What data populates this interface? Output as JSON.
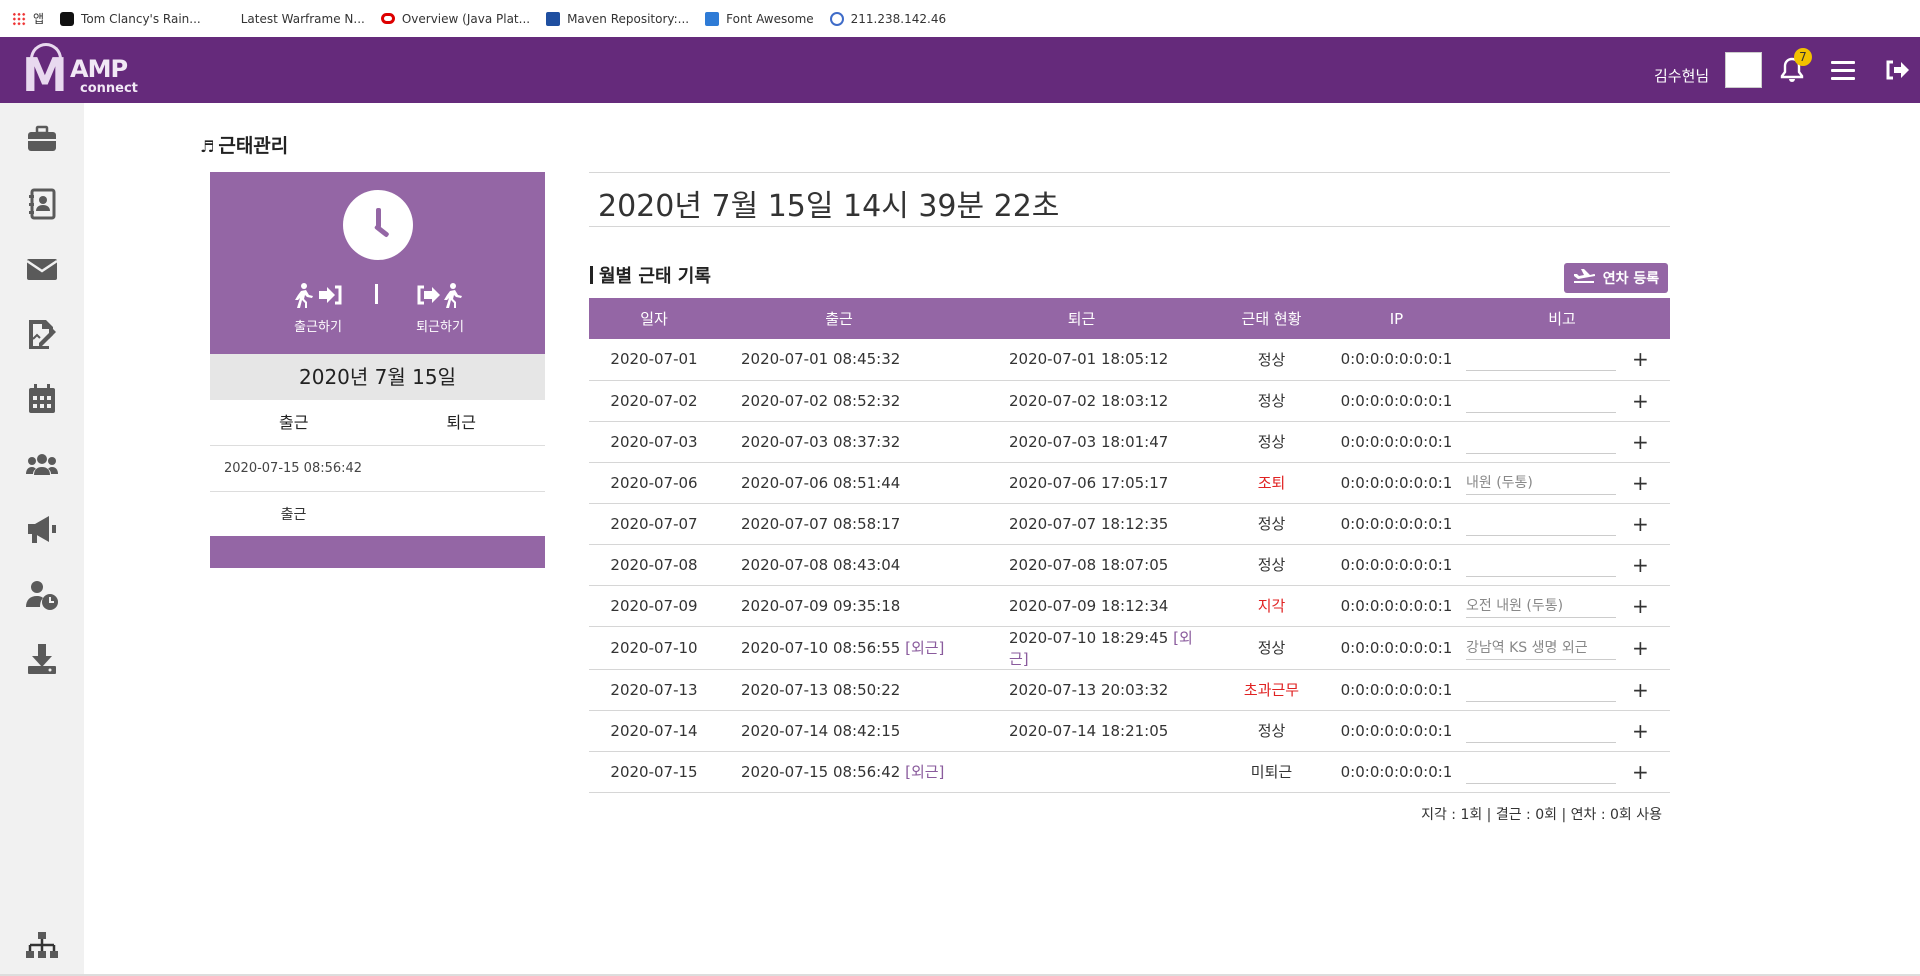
{
  "bookmarks": [
    {
      "label": "앱",
      "icon": "apps-icon"
    },
    {
      "label": "Tom Clancy's Rain...",
      "icon": "r6-icon"
    },
    {
      "label": "Latest Warframe N...",
      "icon": "warframe-icon"
    },
    {
      "label": "Overview (Java Plat...",
      "icon": "oracle-icon"
    },
    {
      "label": "Maven Repository:...",
      "icon": "maven-icon"
    },
    {
      "label": "Font Awesome",
      "icon": "font-awesome-icon"
    },
    {
      "label": "211.238.142.46",
      "icon": "globe-icon"
    }
  ],
  "header": {
    "logo_m": "M",
    "logo_amp": "AMP",
    "logo_connect": "connect",
    "username": "김수현님",
    "notification_count": "7"
  },
  "sidebar_icons": [
    "briefcase-icon",
    "address-book-icon",
    "mail-icon",
    "signature-icon",
    "calendar-icon",
    "users-icon",
    "megaphone-icon",
    "user-clock-icon",
    "download-icon",
    "org-chart-icon"
  ],
  "page": {
    "title": "근태관리",
    "datetime": "2020년 7월 15일 14시 39분 22초"
  },
  "card": {
    "checkin_label": "출근하기",
    "checkout_label": "퇴근하기",
    "date": "2020년 7월 15일",
    "col_in": "출근",
    "col_out": "퇴근",
    "in_time": "2020-07-15 08:56:42",
    "status": "출근"
  },
  "monthly": {
    "title": "월별 근태 기록",
    "leave_button": "연차 등록",
    "columns": [
      "일자",
      "출근",
      "퇴근",
      "근태 현황",
      "IP",
      "비고"
    ],
    "rows": [
      {
        "date": "2020-07-01",
        "in": "2020-07-01 08:45:32",
        "in_tag": "",
        "out": "2020-07-01 18:05:12",
        "out_tag": "",
        "status": "정상",
        "status_color": "#333333",
        "ip": "0:0:0:0:0:0:0:1",
        "note": ""
      },
      {
        "date": "2020-07-02",
        "in": "2020-07-02 08:52:32",
        "in_tag": "",
        "out": "2020-07-02 18:03:12",
        "out_tag": "",
        "status": "정상",
        "status_color": "#333333",
        "ip": "0:0:0:0:0:0:0:1",
        "note": ""
      },
      {
        "date": "2020-07-03",
        "in": "2020-07-03 08:37:32",
        "in_tag": "",
        "out": "2020-07-03 18:01:47",
        "out_tag": "",
        "status": "정상",
        "status_color": "#333333",
        "ip": "0:0:0:0:0:0:0:1",
        "note": ""
      },
      {
        "date": "2020-07-06",
        "in": "2020-07-06 08:51:44",
        "in_tag": "",
        "out": "2020-07-06 17:05:17",
        "out_tag": "",
        "status": "조퇴",
        "status_color": "#e02222",
        "ip": "0:0:0:0:0:0:0:1",
        "note": "내원 (두통)"
      },
      {
        "date": "2020-07-07",
        "in": "2020-07-07 08:58:17",
        "in_tag": "",
        "out": "2020-07-07 18:12:35",
        "out_tag": "",
        "status": "정상",
        "status_color": "#333333",
        "ip": "0:0:0:0:0:0:0:1",
        "note": ""
      },
      {
        "date": "2020-07-08",
        "in": "2020-07-08 08:43:04",
        "in_tag": "",
        "out": "2020-07-08 18:07:05",
        "out_tag": "",
        "status": "정상",
        "status_color": "#333333",
        "ip": "0:0:0:0:0:0:0:1",
        "note": ""
      },
      {
        "date": "2020-07-09",
        "in": "2020-07-09 09:35:18",
        "in_tag": "",
        "out": "2020-07-09 18:12:34",
        "out_tag": "",
        "status": "지각",
        "status_color": "#e02222",
        "ip": "0:0:0:0:0:0:0:1",
        "note": "오전 내원 (두통)"
      },
      {
        "date": "2020-07-10",
        "in": "2020-07-10 08:56:55",
        "in_tag": "[외근]",
        "out": "2020-07-10 18:29:45",
        "out_tag": "[외근]",
        "status": "정상",
        "status_color": "#333333",
        "ip": "0:0:0:0:0:0:0:1",
        "note": "강남역 KS 생명 외근"
      },
      {
        "date": "2020-07-13",
        "in": "2020-07-13 08:50:22",
        "in_tag": "",
        "out": "2020-07-13 20:03:32",
        "out_tag": "",
        "status": "초과근무",
        "status_color": "#e02222",
        "ip": "0:0:0:0:0:0:0:1",
        "note": ""
      },
      {
        "date": "2020-07-14",
        "in": "2020-07-14 08:42:15",
        "in_tag": "",
        "out": "2020-07-14 18:21:05",
        "out_tag": "",
        "status": "정상",
        "status_color": "#333333",
        "ip": "0:0:0:0:0:0:0:1",
        "note": ""
      },
      {
        "date": "2020-07-15",
        "in": "2020-07-15 08:56:42",
        "in_tag": "[외근]",
        "out": "",
        "out_tag": "",
        "status": "미퇴근",
        "status_color": "#333333",
        "ip": "0:0:0:0:0:0:0:1",
        "note": ""
      }
    ],
    "plus_label": "+",
    "summary": "지각 : 1회 | 결근 : 0회 | 연차 : 0회 사용"
  },
  "colors": {
    "header": "#652a7b",
    "accent": "#9466a5",
    "alert": "#e02222"
  }
}
